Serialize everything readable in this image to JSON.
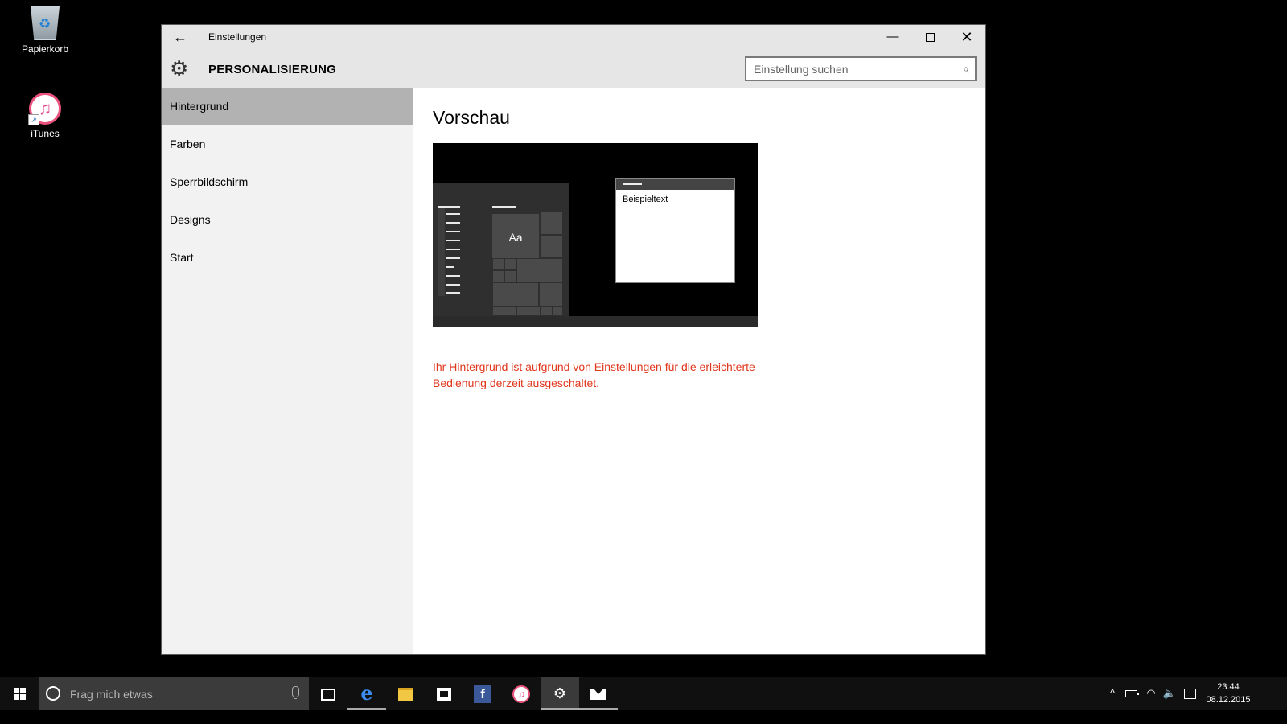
{
  "desktop": {
    "icons": [
      {
        "label": "Papierkorb",
        "icon": "recycle-bin-icon"
      },
      {
        "label": "iTunes",
        "icon": "itunes-icon"
      }
    ]
  },
  "window": {
    "app_title": "Einstellungen",
    "section_title": "PERSONALISIERUNG",
    "search_placeholder": "Einstellung suchen",
    "controls": {
      "back": "←",
      "minimize": "—",
      "close": "✕"
    }
  },
  "sidebar": {
    "items": [
      {
        "label": "Hintergrund",
        "active": true
      },
      {
        "label": "Farben",
        "active": false
      },
      {
        "label": "Sperrbildschirm",
        "active": false
      },
      {
        "label": "Designs",
        "active": false
      },
      {
        "label": "Start",
        "active": false
      }
    ]
  },
  "content": {
    "heading": "Vorschau",
    "preview": {
      "tile_label": "Aa",
      "window_text": "Beispieltext"
    },
    "notice": "Ihr Hintergrund ist aufgrund von Einstellungen für die erleichterte Bedienung derzeit ausgeschaltet.",
    "notice_color": "#e0361c"
  },
  "taskbar": {
    "search_placeholder": "Frag mich etwas",
    "apps": [
      "task-view-icon",
      "edge-icon",
      "file-explorer-icon",
      "store-icon",
      "facebook-icon",
      "itunes-icon",
      "settings-icon",
      "mail-icon"
    ],
    "edge_glyph": "e",
    "facebook_glyph": "f",
    "itunes_glyph": "♫",
    "settings_glyph": "⚙",
    "tray": {
      "chevron": "^",
      "wifi": "◠",
      "volume": "🔈"
    },
    "clock": {
      "time": "23:44",
      "date": "08.12.2015"
    }
  }
}
